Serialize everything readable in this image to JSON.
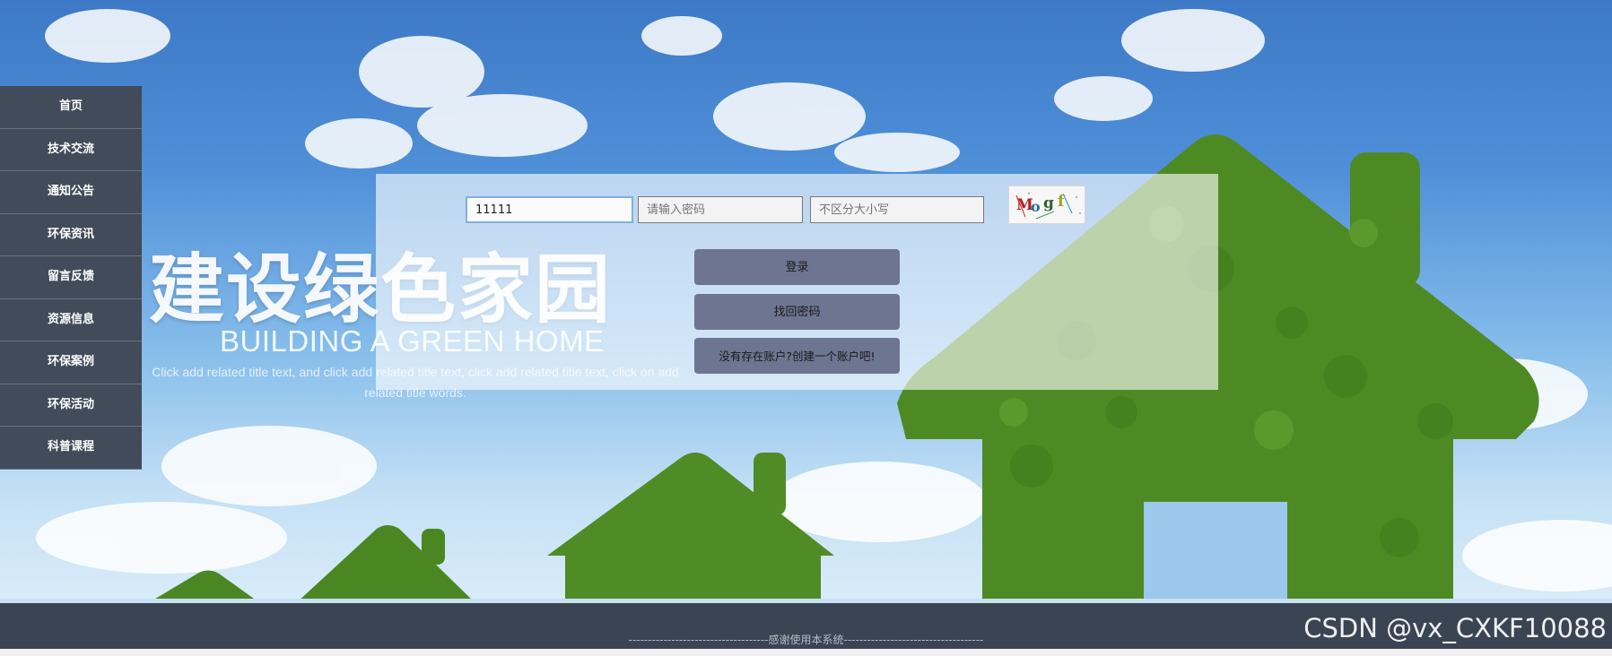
{
  "sidebar": {
    "items": [
      {
        "label": "首页"
      },
      {
        "label": "技术交流"
      },
      {
        "label": "通知公告"
      },
      {
        "label": "环保资讯"
      },
      {
        "label": "留言反馈"
      },
      {
        "label": "资源信息"
      },
      {
        "label": "环保案例"
      },
      {
        "label": "环保活动"
      },
      {
        "label": "科普课程"
      }
    ]
  },
  "hero": {
    "title": "建设绿色家园",
    "subtitle": "BUILDING A GREEN HOME",
    "description": "Click add related title text, and click add related title text, click add related title text, click on add related title words."
  },
  "login": {
    "username_value": "11111",
    "password_placeholder": "请输入密码",
    "captcha_placeholder": "不区分大小写",
    "captcha_text": "Mogf",
    "login_label": "登录",
    "forgot_label": "找回密码",
    "register_label": "没有存在账户?创建一个账户吧!"
  },
  "footer": {
    "text": "------------------------------------感谢使用本系统------------------------------------"
  },
  "watermark": "CSDN @vx_CXKF10088"
}
